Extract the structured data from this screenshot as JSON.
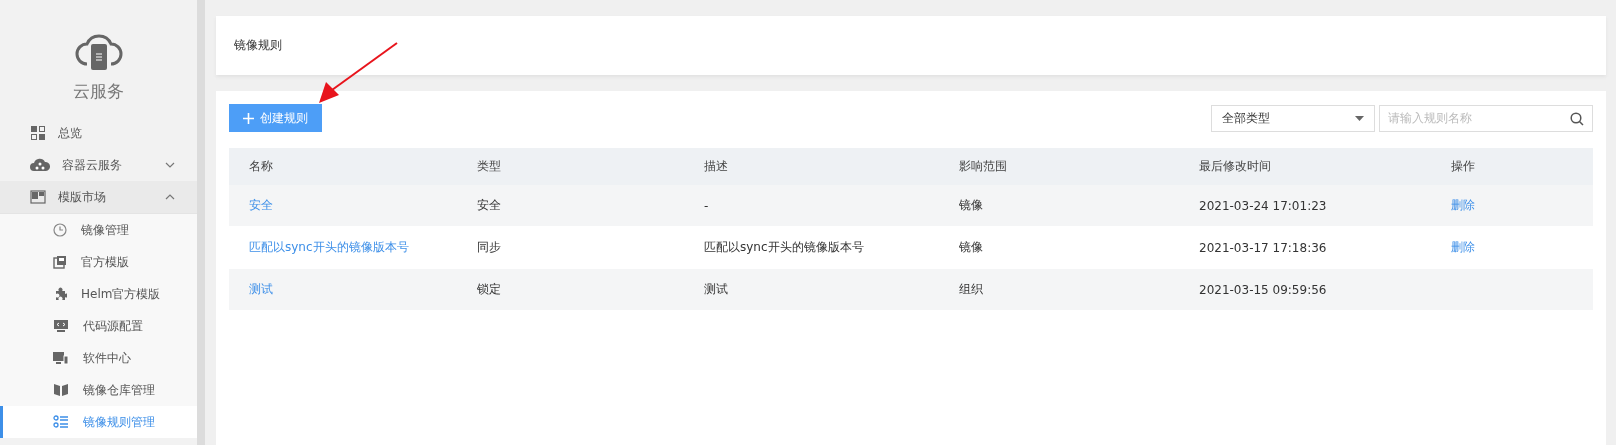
{
  "sidebar": {
    "title": "云服务",
    "items": [
      {
        "kind": "link",
        "label": "总览"
      },
      {
        "kind": "group",
        "label": "容器云服务",
        "expanded": false
      },
      {
        "kind": "group",
        "label": "模版市场",
        "expanded": true,
        "children": [
          {
            "label": "镜像管理",
            "selected": false
          },
          {
            "label": "官方模版",
            "selected": false
          },
          {
            "label": "Helm官方模版",
            "selected": false
          },
          {
            "label": "代码源配置",
            "selected": false
          },
          {
            "label": "软件中心",
            "selected": false
          },
          {
            "label": "镜像仓库管理",
            "selected": false
          },
          {
            "label": "镜像规则管理",
            "selected": true
          }
        ]
      }
    ]
  },
  "header": {
    "title": "镜像规则"
  },
  "toolbar": {
    "create_button": "创建规则",
    "type_filter": "全部类型",
    "search": {
      "placeholder": "请输入规则名称"
    }
  },
  "table": {
    "columns": [
      "名称",
      "类型",
      "描述",
      "影响范围",
      "最后修改时间",
      "操作"
    ],
    "rows": [
      {
        "name": "安全",
        "type": "安全",
        "description": "-",
        "scope": "镜像",
        "modified": "2021-03-24 17:01:23",
        "action": "删除"
      },
      {
        "name": "匹配以sync开头的镜像版本号",
        "type": "同步",
        "description": "匹配以sync开头的镜像版本号",
        "scope": "镜像",
        "modified": "2021-03-17 17:18:36",
        "action": "删除"
      },
      {
        "name": "测试",
        "type": "锁定",
        "description": "测试",
        "scope": "组织",
        "modified": "2021-03-15 09:59:56"
      }
    ]
  }
}
